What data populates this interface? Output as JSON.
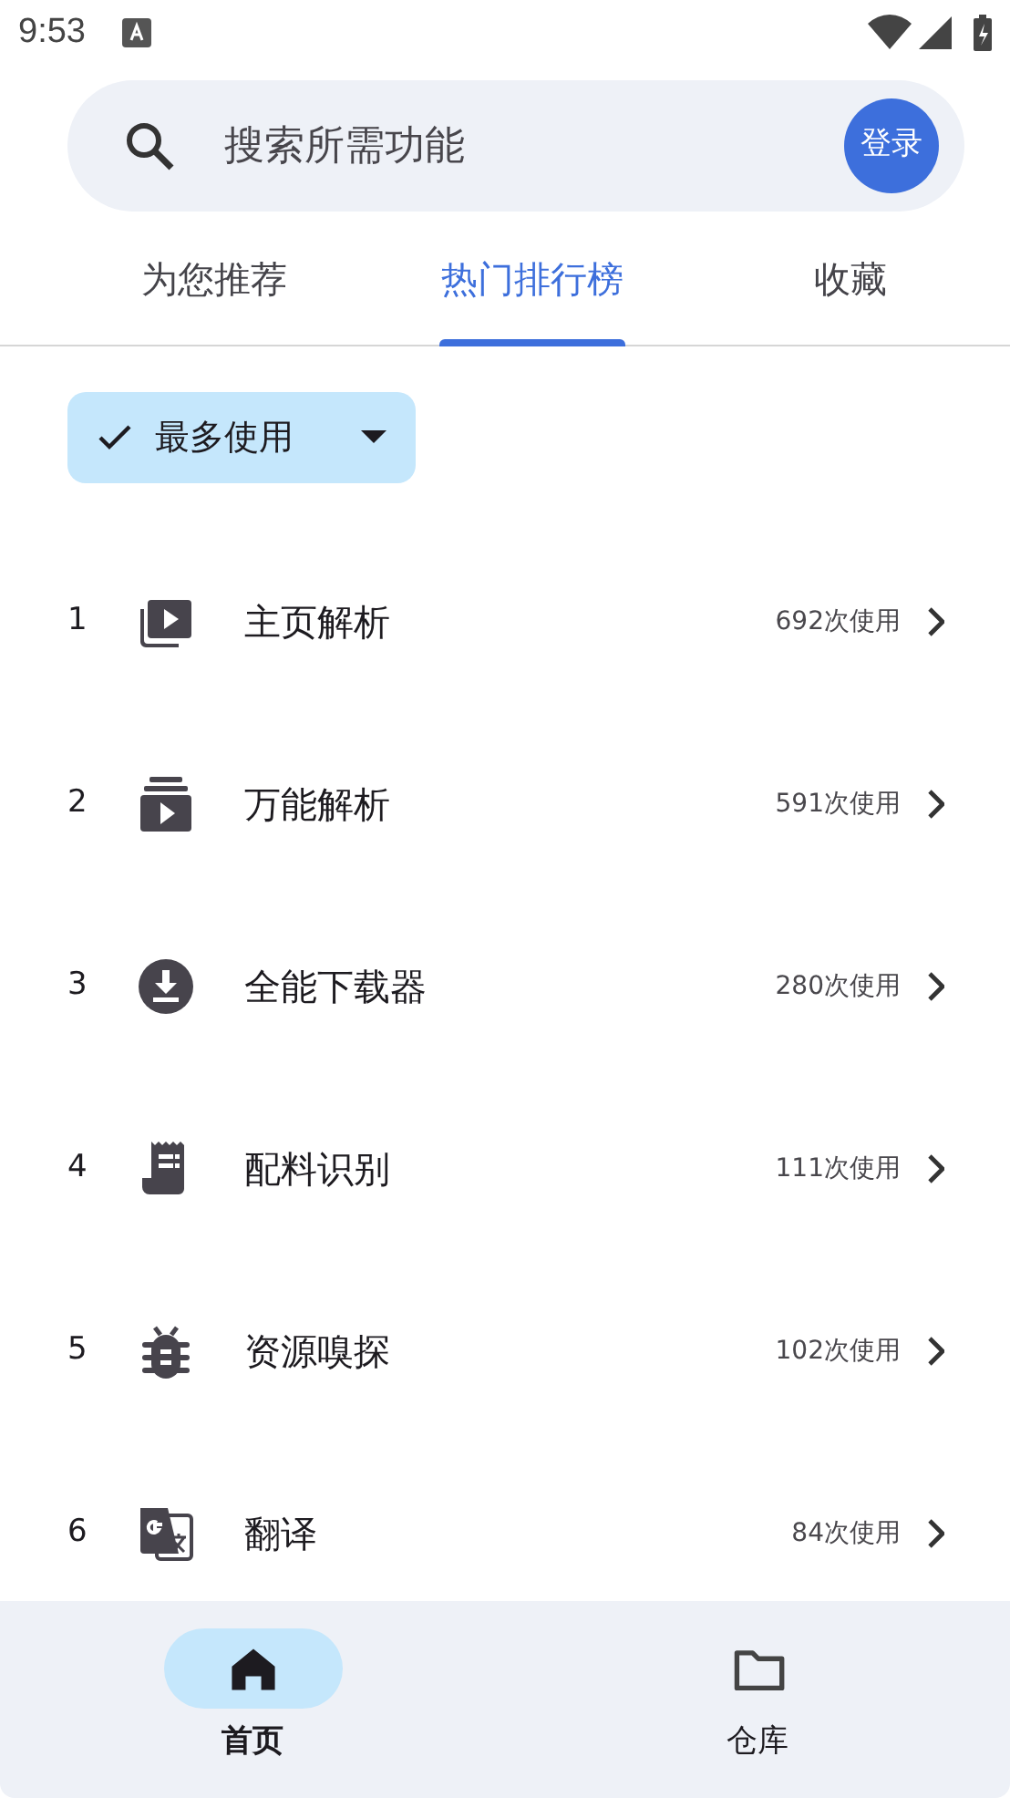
{
  "status_bar": {
    "time": "9:53"
  },
  "search": {
    "placeholder": "搜索所需功能",
    "login": "登录"
  },
  "tabs": [
    {
      "label": "为您推荐",
      "selected": false
    },
    {
      "label": "热门排行榜",
      "selected": true
    },
    {
      "label": "收藏",
      "selected": false
    }
  ],
  "filter_chip": {
    "label": "最多使用",
    "checked": true
  },
  "ranking": [
    {
      "rank": "1",
      "name": "主页解析",
      "usage": "692次使用"
    },
    {
      "rank": "2",
      "name": "万能解析",
      "usage": "591次使用"
    },
    {
      "rank": "3",
      "name": "全能下载器",
      "usage": "280次使用"
    },
    {
      "rank": "4",
      "name": "配料识别",
      "usage": "111次使用"
    },
    {
      "rank": "5",
      "name": "资源嗅探",
      "usage": "102次使用"
    },
    {
      "rank": "6",
      "name": "翻译",
      "usage": "84次使用"
    }
  ],
  "bottom_nav": [
    {
      "label": "首页",
      "selected": true
    },
    {
      "label": "仓库",
      "selected": false
    }
  ]
}
